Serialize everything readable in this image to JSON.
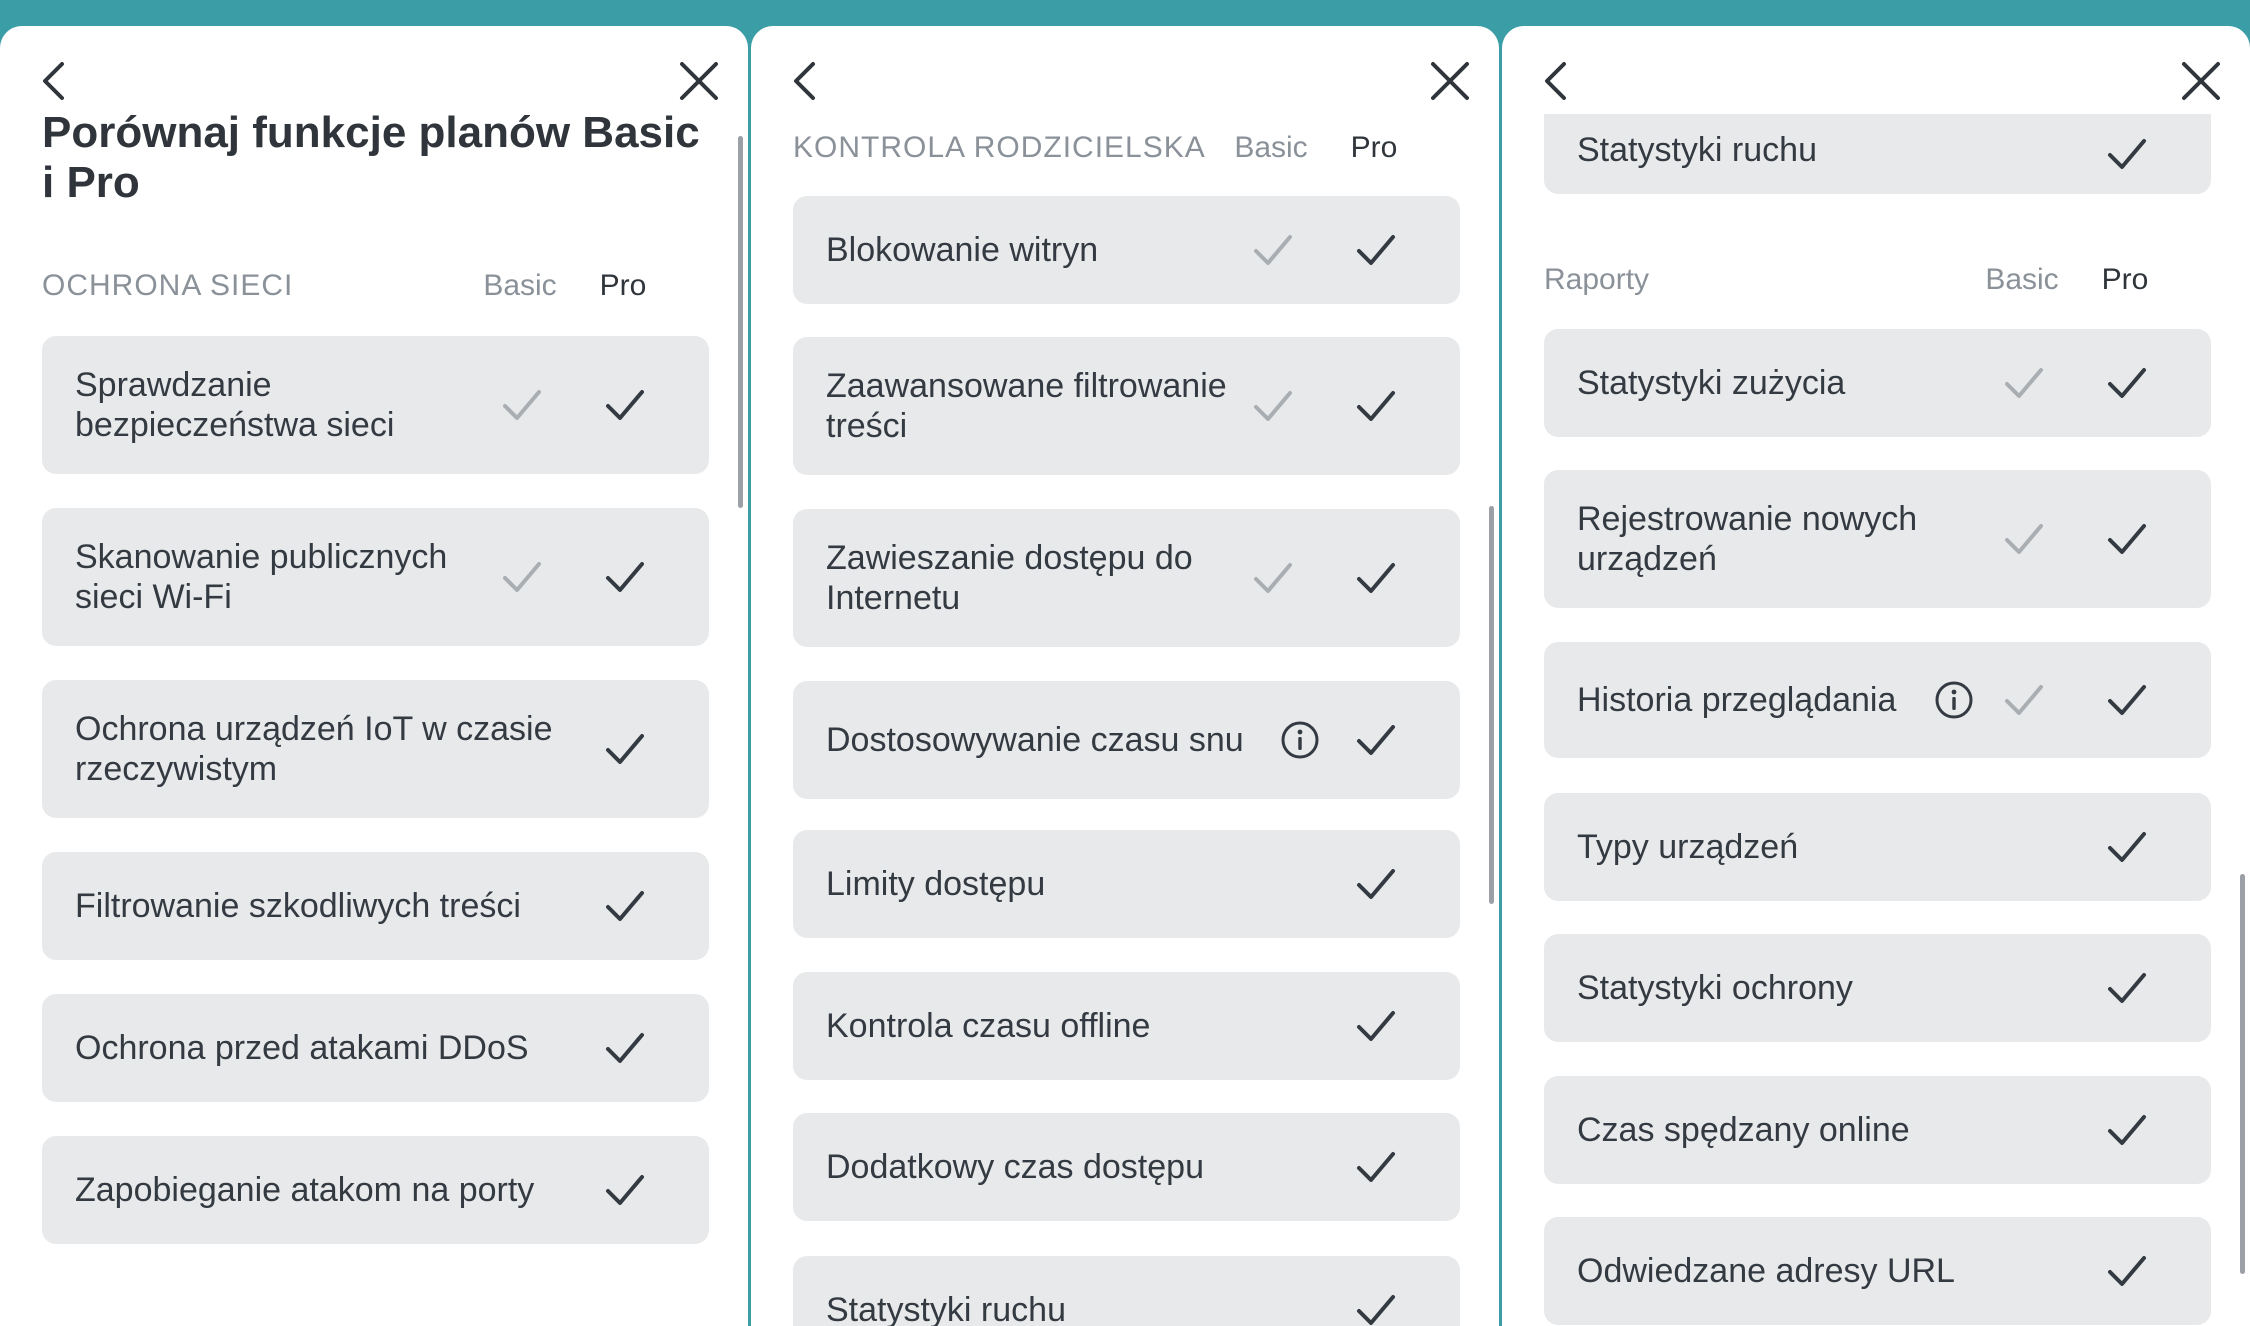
{
  "colors": {
    "background": "#3b9ea6",
    "row_bg": "#e8e9eb",
    "check_pro": "#333a41",
    "check_basic": "#a9aeb3"
  },
  "icons": {
    "back": "chevron-left-icon",
    "close": "close-icon",
    "check": "checkmark-icon",
    "info": "info-icon"
  },
  "panel1": {
    "title": "Porównaj funkcje planów Basic i Pro",
    "section": {
      "title": "OCHRONA SIECI",
      "basic": "Basic",
      "pro": "Pro"
    },
    "rows": [
      {
        "label": "Sprawdzanie bezpieczeństwa sieci",
        "basic": true,
        "pro": true
      },
      {
        "label": "Skanowanie publicznych sieci Wi-Fi",
        "basic": true,
        "pro": true
      },
      {
        "label": "Ochrona urządzeń IoT w czasie rzeczywistym",
        "basic": false,
        "pro": true
      },
      {
        "label": "Filtrowanie szkodliwych treści",
        "basic": false,
        "pro": true
      },
      {
        "label": "Ochrona przed atakami DDoS",
        "basic": false,
        "pro": true
      },
      {
        "label": "Zapobieganie atakom na porty",
        "basic": false,
        "pro": true
      }
    ]
  },
  "panel2": {
    "section": {
      "title": "KONTROLA RODZICIELSKA",
      "basic": "Basic",
      "pro": "Pro"
    },
    "rows": [
      {
        "label": "Blokowanie witryn",
        "basic": true,
        "pro": true
      },
      {
        "label": "Zaawansowane filtrowanie treści",
        "basic": true,
        "pro": true
      },
      {
        "label": "Zawieszanie dostępu do Internetu",
        "basic": true,
        "pro": true
      },
      {
        "label": "Dostosowywanie czasu snu",
        "info": true,
        "basic": false,
        "pro": true
      },
      {
        "label": "Limity dostępu",
        "basic": false,
        "pro": true
      },
      {
        "label": "Kontrola czasu offline",
        "basic": false,
        "pro": true
      },
      {
        "label": "Dodatkowy czas dostępu",
        "basic": false,
        "pro": true
      },
      {
        "label": "Statystyki ruchu",
        "basic": false,
        "pro": true
      }
    ]
  },
  "panel3": {
    "top_row": {
      "label": "Statystyki ruchu",
      "basic": false,
      "pro": true
    },
    "section": {
      "title": "Raporty",
      "basic": "Basic",
      "pro": "Pro"
    },
    "rows": [
      {
        "label": "Statystyki zużycia",
        "basic": true,
        "pro": true
      },
      {
        "label": "Rejestrowanie nowych urządzeń",
        "basic": true,
        "pro": true
      },
      {
        "label": "Historia przeglądania",
        "info": true,
        "basic": true,
        "pro": true
      },
      {
        "label": "Typy urządzeń",
        "basic": false,
        "pro": true
      },
      {
        "label": "Statystyki ochrony",
        "basic": false,
        "pro": true
      },
      {
        "label": "Czas spędzany online",
        "basic": false,
        "pro": true
      },
      {
        "label": "Odwiedzane adresy URL",
        "basic": false,
        "pro": true
      }
    ]
  }
}
